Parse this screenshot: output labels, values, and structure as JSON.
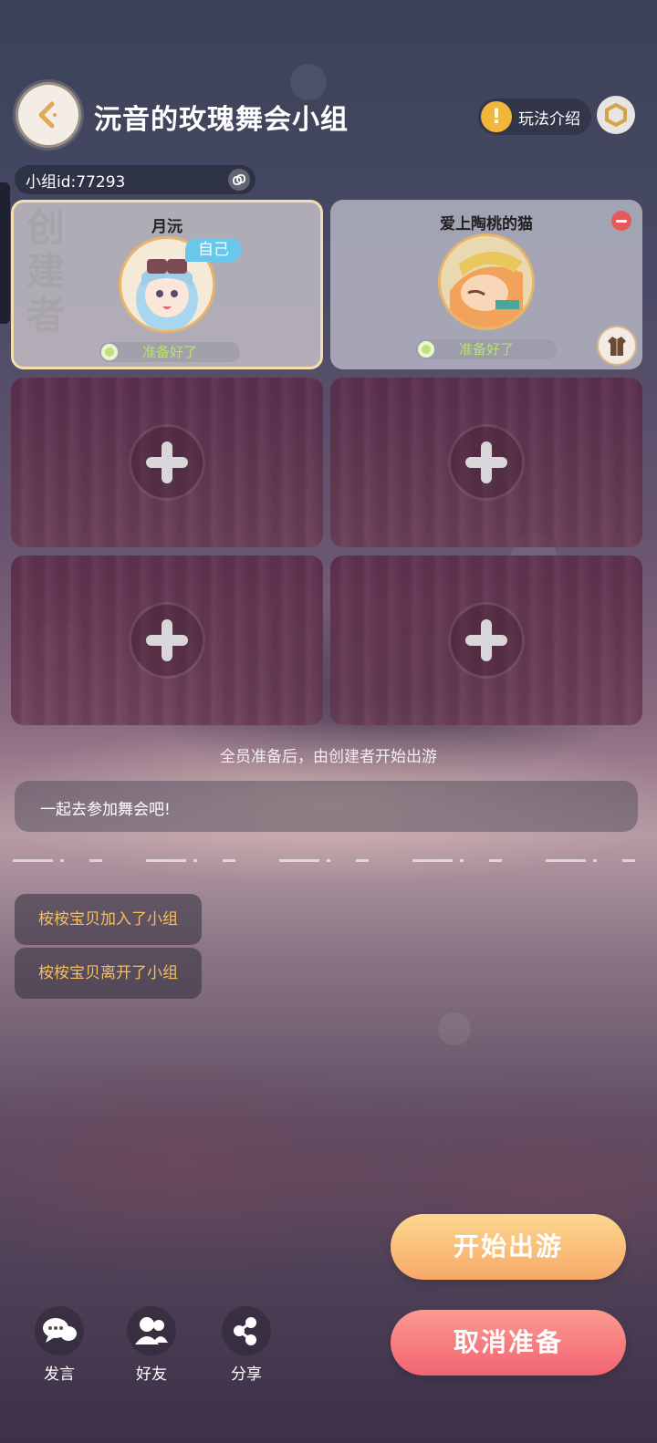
{
  "header": {
    "title": "沅音的玫瑰舞会小组",
    "rules_label": "玩法介绍",
    "rules_icon": "!"
  },
  "group": {
    "id_text": "小组id:77293"
  },
  "members": [
    {
      "name": "月沅",
      "is_self": true,
      "self_badge": "自己",
      "status": "准备好了",
      "creator_mark": "创建者"
    },
    {
      "name": "爱上陶桃的猫",
      "is_self": false,
      "status": "准备好了"
    }
  ],
  "hint": "全员准备后，由创建者开始出游",
  "chat": {
    "preset_message": "一起去参加舞会吧!"
  },
  "system_messages": [
    "桉桉宝贝加入了小组",
    "桉桉宝贝离开了小组"
  ],
  "actions": {
    "start_label": "开始出游",
    "cancel_label": "取消准备"
  },
  "toolbar": [
    {
      "label": "发言",
      "icon": "chat-icon"
    },
    {
      "label": "好友",
      "icon": "friends-icon"
    },
    {
      "label": "分享",
      "icon": "share-icon"
    }
  ],
  "colors": {
    "accent_gold": "#f4bf63",
    "ready_green": "#b8e36a",
    "start_button": "#f7a968",
    "cancel_button": "#f16572",
    "self_badge": "#69c7ec"
  }
}
